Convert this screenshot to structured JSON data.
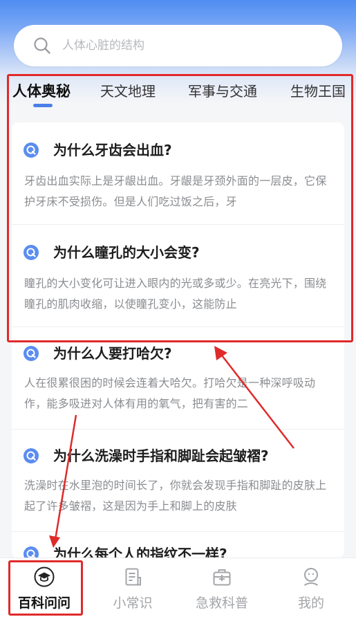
{
  "search": {
    "placeholder": "人体心脏的结构"
  },
  "tabs": [
    {
      "label": "人体奥秘",
      "active": true
    },
    {
      "label": "天文地理",
      "active": false
    },
    {
      "label": "军事与交通",
      "active": false
    },
    {
      "label": "生物王国",
      "active": false
    }
  ],
  "articles": [
    {
      "title": "为什么牙齿会出血?",
      "body": "牙齿出血实际上是牙龈出血。牙龈是牙颈外面的一层皮，它保护牙床不受损伤。但是人们吃过饭之后，牙"
    },
    {
      "title": "为什么瞳孔的大小会变?",
      "body": "瞳孔的大小变化可让进入眼内的光或多或少。在亮光下，围绕瞳孔的肌肉收缩，以使瞳孔变小，这能防止"
    },
    {
      "title": "为什么人要打哈欠?",
      "body": "人在很累很困的时候会连着大哈欠。打哈欠是一种深呼吸动作，能多吸进对人体有用的氧气，把有害的二"
    },
    {
      "title": "为什么洗澡时手指和脚趾会起皱褶?",
      "body": "洗澡时在水里泡的时间长了，你就会发现手指和脚趾的皮肤上起了许多皱褶，这是因为手上和脚上的皮肤"
    },
    {
      "title": "为什么每个人的指纹不一样?",
      "body": ""
    }
  ],
  "nav": [
    {
      "label": "百科问问",
      "icon": "graduation-cap-icon",
      "active": true
    },
    {
      "label": "小常识",
      "icon": "note-icon",
      "active": false
    },
    {
      "label": "急救科普",
      "icon": "first-aid-kit-icon",
      "active": false
    },
    {
      "label": "我的",
      "icon": "user-face-icon",
      "active": false
    }
  ],
  "colors": {
    "accent": "#4d7fe8",
    "annotation": "#e02a2a",
    "header": "#4f8df2"
  }
}
